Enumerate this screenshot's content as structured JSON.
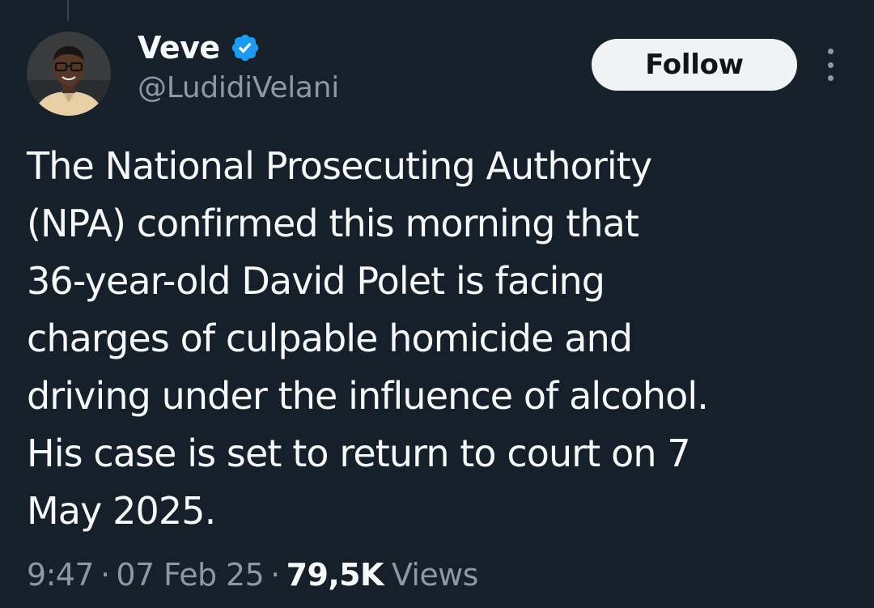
{
  "author": {
    "display_name": "Veve",
    "handle": "@LudidiVelani",
    "verified": true,
    "verified_icon": "verified-badge-icon"
  },
  "actions": {
    "follow_label": "Follow",
    "more_icon": "more-options-icon"
  },
  "tweet": {
    "text_lines": [
      "The National Prosecuting Authority",
      "(NPA) confirmed this morning that",
      "36-year-old David Polet is facing",
      "charges of culpable homicide and",
      "driving under the influence of alcohol.",
      "His case is set to return to court on 7",
      "May 2025."
    ]
  },
  "meta": {
    "time": "9:47",
    "separator": "·",
    "date": "07 Feb 25",
    "views_count": "79,5K",
    "views_label": "Views"
  },
  "colors": {
    "background": "#15202b",
    "primary_text": "#f7f9f9",
    "secondary_text": "#8b98a5",
    "verified_blue": "#1d9bf0",
    "follow_bg": "#eff3f4"
  }
}
